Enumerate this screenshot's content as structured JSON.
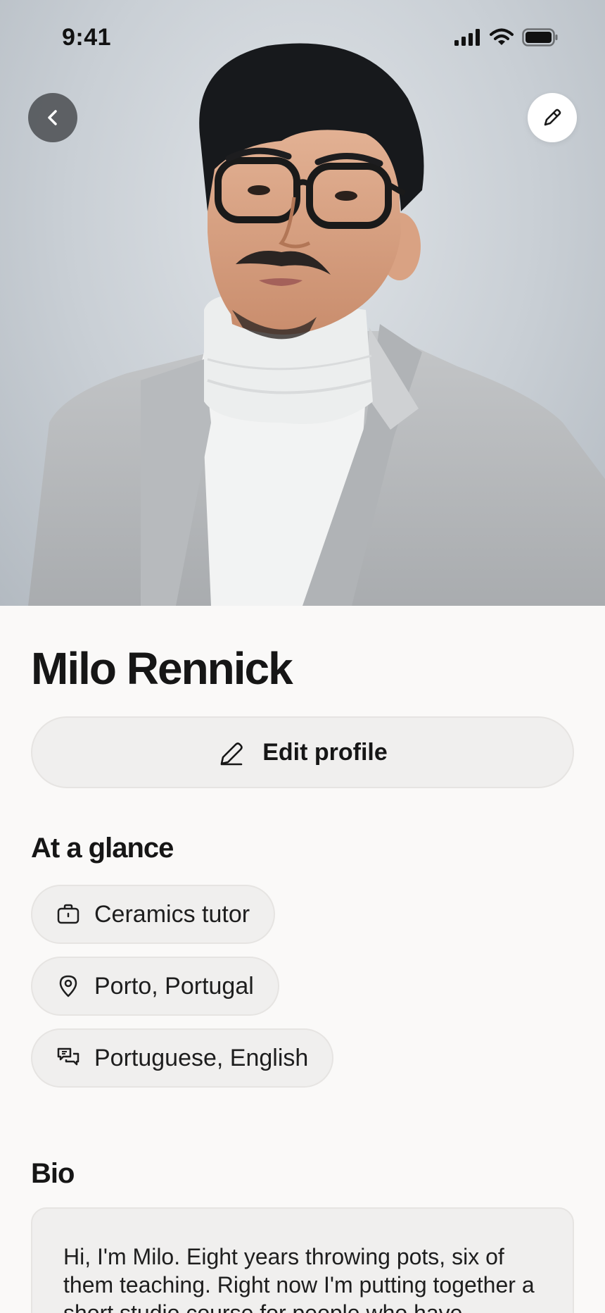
{
  "status_bar": {
    "time": "9:41",
    "icons": [
      "cellular-signal-icon",
      "wifi-icon",
      "battery-icon"
    ]
  },
  "hero": {
    "image": "portrait of man with glasses, white turtleneck and grey blazer",
    "back_icon": "chevron-left-icon",
    "edit_icon": "pencil-icon"
  },
  "profile": {
    "name": "Milo Rennick",
    "edit_button_label": "Edit profile",
    "edit_button_icon": "pencil-icon"
  },
  "at_a_glance": {
    "title": "At a glance",
    "items": [
      {
        "icon": "briefcase-icon",
        "label": "Ceramics tutor"
      },
      {
        "icon": "location-pin-icon",
        "label": "Porto, Portugal"
      },
      {
        "icon": "speech-bubbles-icon",
        "label": "Portuguese, English"
      }
    ]
  },
  "bio": {
    "title": "Bio",
    "text": "Hi, I'm Milo. Eight years throwing pots, six of them teaching. Right now I'm putting together a short studio course for people who have"
  },
  "colors": {
    "background": "#faf9f8",
    "chip_background": "#f0efee",
    "text": "#161616"
  }
}
